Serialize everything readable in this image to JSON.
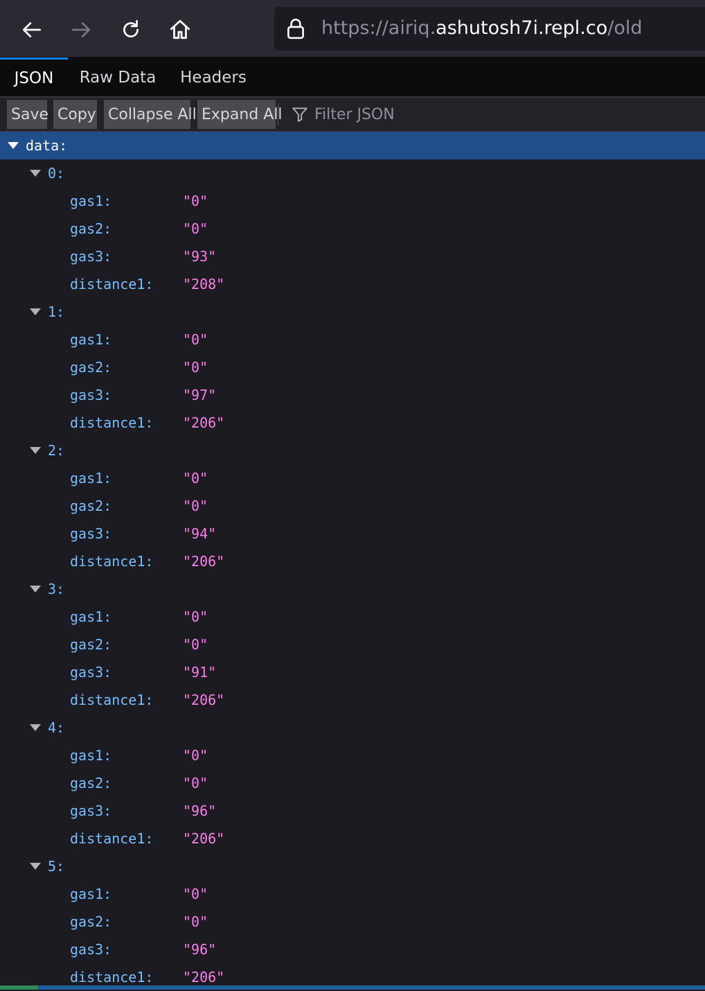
{
  "browser": {
    "url_prefix": "https://airiq.",
    "url_domain": "ashutosh7i.repl.co",
    "url_path": "/old"
  },
  "tabs": [
    {
      "label": "JSON"
    },
    {
      "label": "Raw Data"
    },
    {
      "label": "Headers"
    }
  ],
  "toolbar": {
    "save_label": "Save",
    "copy_label": "Copy",
    "collapse_label": "Collapse All",
    "expand_label": "Expand All",
    "filter_placeholder": "Filter JSON"
  },
  "tree": {
    "root_key": "data:",
    "items": [
      {
        "index": "0:",
        "gas1_key": "gas1:",
        "gas1": "\"0\"",
        "gas2_key": "gas2:",
        "gas2": "\"0\"",
        "gas3_key": "gas3:",
        "gas3": "\"93\"",
        "distance1_key": "distance1:",
        "distance1": "\"208\""
      },
      {
        "index": "1:",
        "gas1_key": "gas1:",
        "gas1": "\"0\"",
        "gas2_key": "gas2:",
        "gas2": "\"0\"",
        "gas3_key": "gas3:",
        "gas3": "\"97\"",
        "distance1_key": "distance1:",
        "distance1": "\"206\""
      },
      {
        "index": "2:",
        "gas1_key": "gas1:",
        "gas1": "\"0\"",
        "gas2_key": "gas2:",
        "gas2": "\"0\"",
        "gas3_key": "gas3:",
        "gas3": "\"94\"",
        "distance1_key": "distance1:",
        "distance1": "\"206\""
      },
      {
        "index": "3:",
        "gas1_key": "gas1:",
        "gas1": "\"0\"",
        "gas2_key": "gas2:",
        "gas2": "\"0\"",
        "gas3_key": "gas3:",
        "gas3": "\"91\"",
        "distance1_key": "distance1:",
        "distance1": "\"206\""
      },
      {
        "index": "4:",
        "gas1_key": "gas1:",
        "gas1": "\"0\"",
        "gas2_key": "gas2:",
        "gas2": "\"0\"",
        "gas3_key": "gas3:",
        "gas3": "\"96\"",
        "distance1_key": "distance1:",
        "distance1": "\"206\""
      },
      {
        "index": "5:",
        "gas1_key": "gas1:",
        "gas1": "\"0\"",
        "gas2_key": "gas2:",
        "gas2": "\"0\"",
        "gas3_key": "gas3:",
        "gas3": "\"96\"",
        "distance1_key": "distance1:",
        "distance1": "\"206\""
      }
    ]
  }
}
